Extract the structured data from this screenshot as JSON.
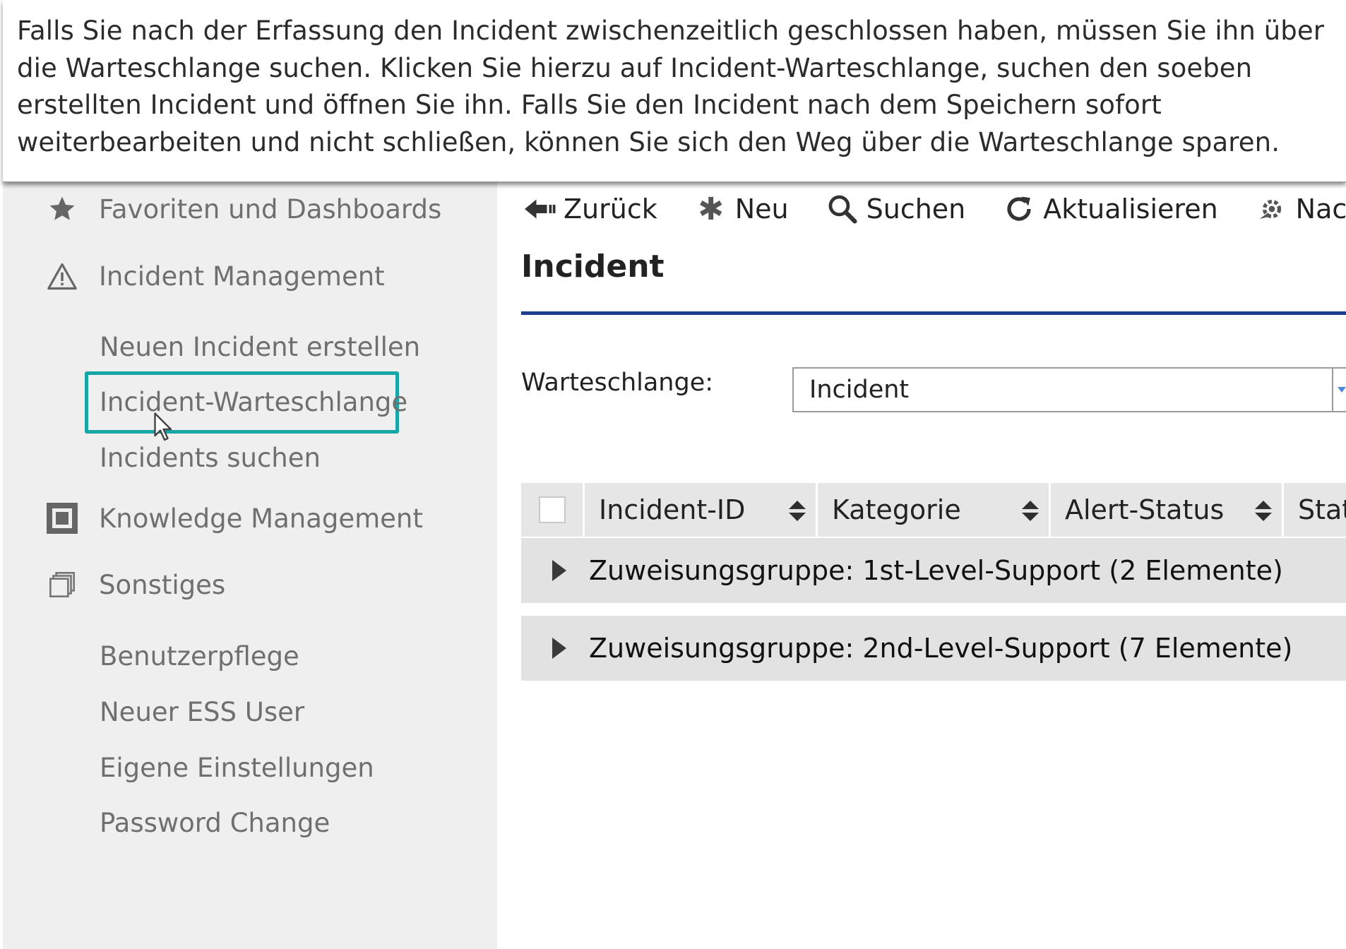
{
  "instruction": {
    "lines": [
      "Falls Sie nach der Erfassung den Incident zwischenzeitlich geschlossen haben, müssen Sie ihn über",
      "die Warteschlange suchen. Klicken Sie hierzu auf Incident-Warteschlange, suchen den soeben",
      "erstellten Incident und öffnen Sie ihn. Falls Sie den Incident nach dem Speichern sofort",
      "weiterbearbeiten und nicht schließen, können Sie sich den Weg über die Warteschlange sparen."
    ]
  },
  "sidebar": {
    "favorites": {
      "label": "Favoriten und Dashboards",
      "icon": "star-icon"
    },
    "incident_management": {
      "label": "Incident Management",
      "icon": "warning-icon",
      "items": [
        "Neuen Incident erstellen",
        "Incident-Warteschlange",
        "Incidents suchen"
      ]
    },
    "knowledge": {
      "label": "Knowledge Management",
      "icon": "knowledge-icon"
    },
    "other": {
      "label": "Sonstiges",
      "icon": "stack-icon",
      "items": [
        "Benutzerpflege",
        "Neuer ESS User",
        "Eigene Einstellungen",
        "Password Change"
      ]
    },
    "highlight_color": "#17a5a5"
  },
  "toolbar": {
    "back": "Zurück",
    "new": "Neu",
    "search": "Suchen",
    "refresh": "Aktualisieren",
    "next": "Nach"
  },
  "page": {
    "title": "Incident",
    "accent_color": "#1d3e8f"
  },
  "queue": {
    "label": "Warteschlange:",
    "value": "Incident"
  },
  "grid": {
    "columns": [
      "Incident-ID",
      "Kategorie",
      "Alert-Status",
      "Stat"
    ],
    "groups": [
      "Zuweisungsgruppe: 1st-Level-Support (2 Elemente)",
      "Zuweisungsgruppe: 2nd-Level-Support (7 Elemente)"
    ]
  }
}
